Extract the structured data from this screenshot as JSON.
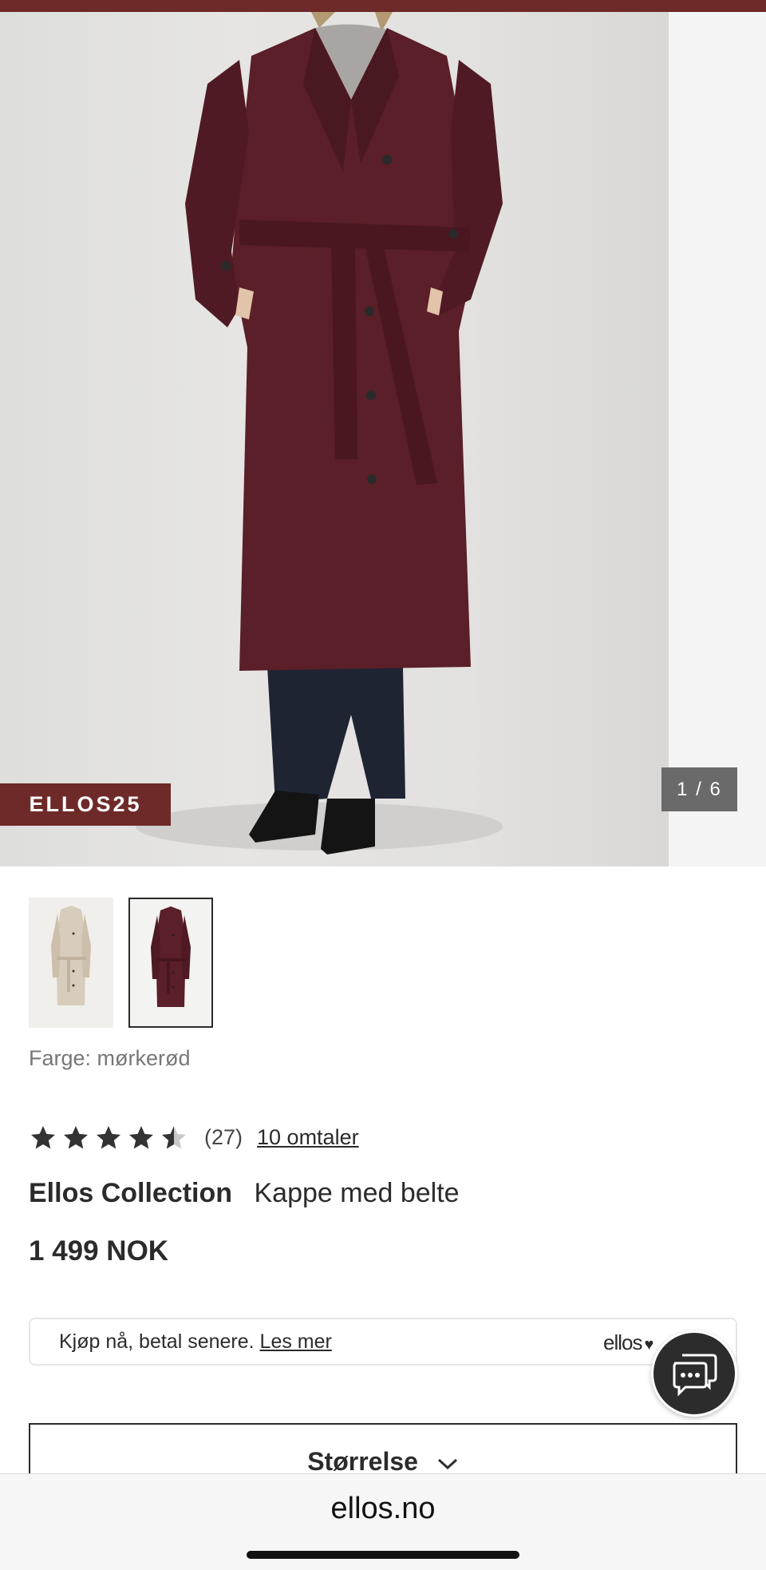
{
  "hero": {
    "promo_code": "ELLOS25",
    "image_counter": "1 / 6"
  },
  "product": {
    "color_label": "Farge: mørkerød",
    "rating": {
      "stars": 4.5,
      "count_text": "(27)",
      "reviews_link": "10 omtaler"
    },
    "brand": "Ellos Collection",
    "name": "Kappe med belte",
    "price": "1 499 NOK"
  },
  "payment": {
    "text": "Kjøp nå, betal senere.",
    "link": "Les mer",
    "logo": "ellos"
  },
  "size_selector": {
    "label": "Størrelse"
  },
  "browser": {
    "url": "ellos.no"
  },
  "colors": {
    "accent": "#6e2a28",
    "coat": "#5a1f28"
  }
}
